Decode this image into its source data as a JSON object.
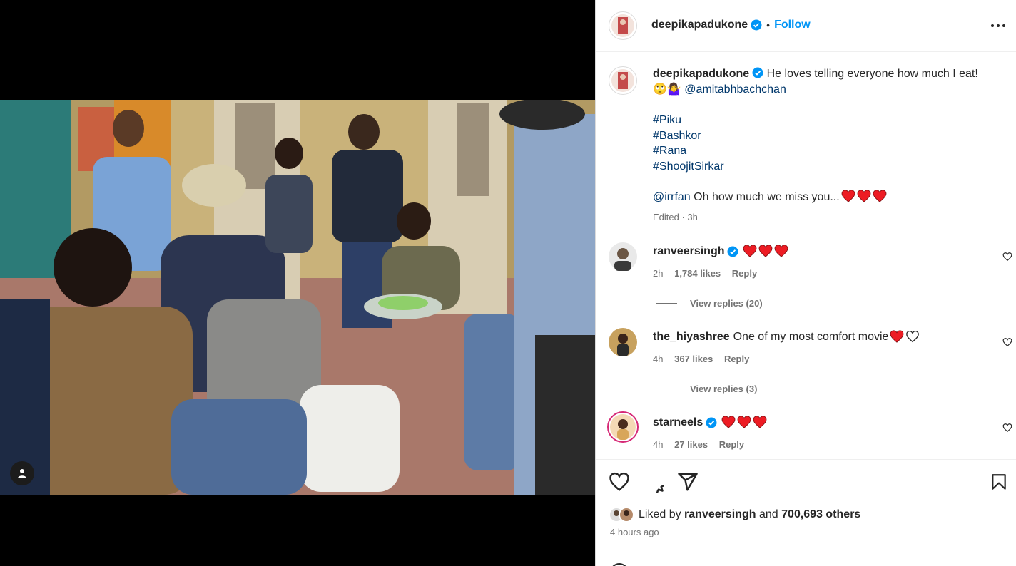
{
  "post": {
    "username": "deepikapadukone",
    "follow_label": "Follow",
    "caption_line1": "He loves telling everyone how much I eat!",
    "caption_emoji": "🙄🤷‍♀️",
    "mention": "@amitabhbachchan",
    "hashtags": [
      "#Piku",
      "#Bashkor",
      "#Rana",
      "#ShoojitSirkar"
    ],
    "mention2": "@irrfan",
    "caption_line2": "Oh how much we miss you...",
    "edited": "Edited · 3h"
  },
  "comments": [
    {
      "username": "ranveersingh",
      "verified": true,
      "text": "",
      "hearts": 3,
      "time": "2h",
      "likes": "1,784 likes",
      "reply": "Reply",
      "view_replies": "View replies (20)"
    },
    {
      "username": "the_hiyashree",
      "verified": false,
      "text": "One of my most comfort movie",
      "hearts": 1,
      "time": "4h",
      "likes": "367 likes",
      "reply": "Reply",
      "view_replies": "View replies (3)"
    },
    {
      "username": "starneels",
      "verified": true,
      "text": "",
      "hearts": 3,
      "time": "4h",
      "likes": "27 likes",
      "reply": "Reply"
    }
  ],
  "likes_summary": {
    "prefix": "Liked by",
    "user": "ranveersingh",
    "connector": "and",
    "others": "700,693 others"
  },
  "time_ago": "4 hours ago",
  "colors": {
    "link": "#00376b",
    "follow": "#0095f6",
    "verified": "#0095f6",
    "heart": "#ed1c24"
  },
  "icons": [
    "tag-user-icon",
    "more-icon",
    "verified-icon",
    "like-icon",
    "comment-icon",
    "share-icon",
    "save-icon",
    "emoji-icon"
  ]
}
